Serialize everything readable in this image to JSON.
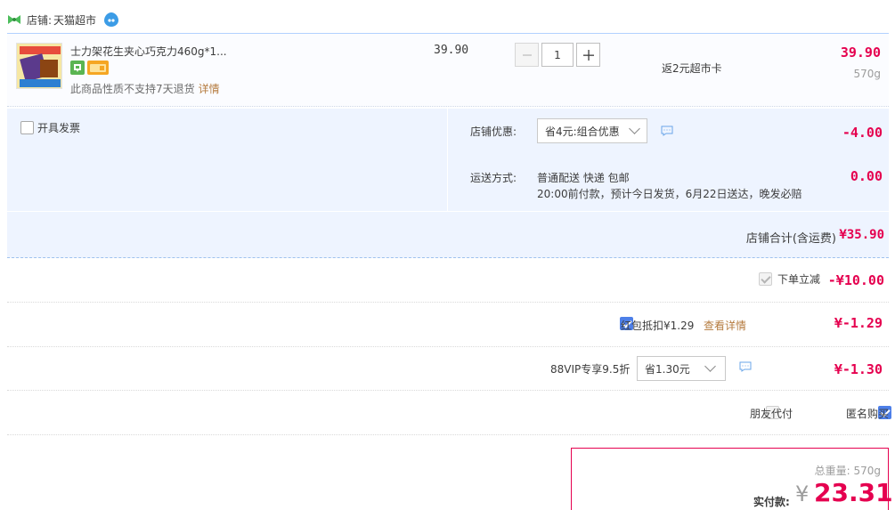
{
  "shop": {
    "label": "店铺:",
    "name": "天猫超市"
  },
  "item": {
    "title": "士力架花生夹心巧克力460g*1...",
    "note": "此商品性质不支持7天退货",
    "note_link": "详情",
    "unit_price": "39.90",
    "quantity": "1",
    "rebate": "返2元超市卡",
    "subtotal": "39.90",
    "weight": "570g"
  },
  "options": {
    "invoice_label": "开具发票",
    "shop_discount_label": "店铺优惠:",
    "shop_discount_selected": "省4元:组合优惠",
    "shop_discount_amount": "-4.00",
    "shipping_label": "运送方式:",
    "shipping_line1": "普通配送 快递 包邮",
    "shipping_line2": "20:00前付款，预计今日发货，6月22日送达，晚发必赔",
    "shipping_amount": "0.00"
  },
  "shop_total": {
    "label": "店铺合计(含运费)",
    "value": "¥35.90"
  },
  "discounts": {
    "instant_label": "下单立减",
    "instant_value": "-¥10.00",
    "redpacket_label": "红包抵扣¥1.29",
    "redpacket_link": "查看详情",
    "redpacket_value": "¥-1.29",
    "vip_label": "88VIP专享9.5折",
    "vip_selected": "省1.30元",
    "vip_value": "¥-1.30",
    "friend_pay_label": "朋友代付",
    "anonymous_label": "匿名购买"
  },
  "summary": {
    "total_weight": "总重量: 570g",
    "pay_label": "实付款:",
    "pay_currency": "¥",
    "pay_value": "23.31"
  },
  "colors": {
    "accent": "#e5004f",
    "link": "#b57b3f",
    "checkbox": "#4d7fe8",
    "panel": "#eef4ff"
  }
}
